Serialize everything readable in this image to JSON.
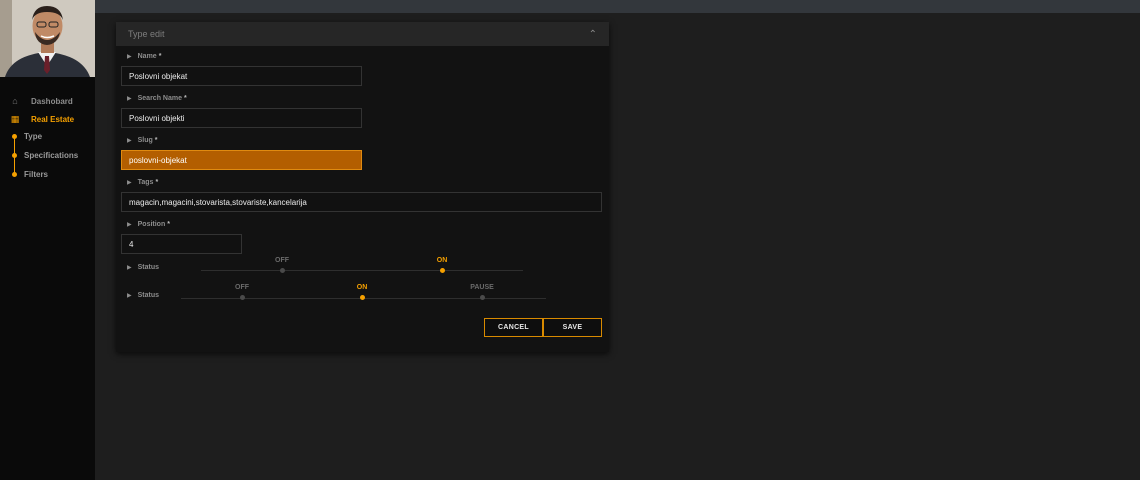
{
  "sidebar": {
    "nav": [
      {
        "label": "Dashobard",
        "icon": "home-icon"
      },
      {
        "label": "Real Estate",
        "icon": "building-icon"
      }
    ],
    "sub_items": [
      {
        "label": "Type"
      },
      {
        "label": "Specifications"
      },
      {
        "label": "Filters"
      }
    ]
  },
  "panel": {
    "title": "Type edit",
    "fields": [
      {
        "label": "Name",
        "required": "*",
        "value": "Poslovni objekat"
      },
      {
        "label": "Search Name",
        "required": "*",
        "value": "Poslovni objekti"
      },
      {
        "label": "Slug",
        "required": "*",
        "value": "poslovni-objekat"
      },
      {
        "label": "Tags",
        "required": "*",
        "value": "magacin,magacini,stovarista,stovariste,kancelarija"
      },
      {
        "label": "Position",
        "required": "*",
        "value": "4"
      }
    ],
    "status_toggles": [
      {
        "label": "Status",
        "options": [
          "OFF",
          "ON"
        ],
        "selected": "ON"
      },
      {
        "label": "Status",
        "options": [
          "OFF",
          "ON",
          "PAUSE"
        ],
        "selected": "ON"
      }
    ],
    "buttons": {
      "cancel": "CANCEL",
      "save": "SAVE"
    }
  },
  "colors": {
    "accent": "#f5a000",
    "focused_input": "#b35e00",
    "background": "#1e1e1e",
    "sidebar": "#0a0a0a",
    "topbar": "#33373c"
  }
}
